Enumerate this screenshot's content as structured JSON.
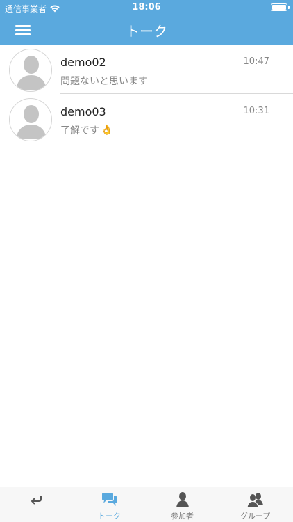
{
  "status": {
    "carrier": "通信事業者",
    "time": "18:06"
  },
  "header": {
    "title": "トーク"
  },
  "talks": [
    {
      "name": "demo02",
      "time": "10:47",
      "preview": "問題ないと思います",
      "emoji": ""
    },
    {
      "name": "demo03",
      "time": "10:31",
      "preview": "了解です",
      "emoji": "👌"
    }
  ],
  "tabbar": {
    "back_icon": "return-icon",
    "items": [
      {
        "label": "トーク",
        "icon": "chat-bubbles-icon",
        "active": true
      },
      {
        "label": "参加者",
        "icon": "person-icon",
        "active": false
      },
      {
        "label": "グループ",
        "icon": "group-icon",
        "active": false
      }
    ]
  },
  "colors": {
    "accent": "#5aa9de",
    "active_tab": "#5aa9de",
    "inactive_tab": "#7a7a7a"
  }
}
